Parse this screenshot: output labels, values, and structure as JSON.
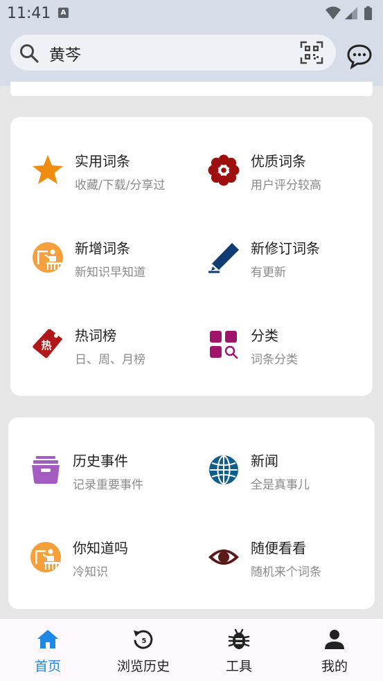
{
  "status_bar": {
    "time": "11:41",
    "notification_letter": "A"
  },
  "search": {
    "query": "黄芩"
  },
  "sections": [
    {
      "items": [
        {
          "title": "实用词条",
          "subtitle": "收藏/下载/分享过",
          "icon": "star-icon",
          "color": "#f08c12"
        },
        {
          "title": "优质词条",
          "subtitle": "用户评分较高",
          "icon": "flower-icon",
          "color": "#9e1010"
        },
        {
          "title": "新增词条",
          "subtitle": "新知识早知道",
          "icon": "teacher-icon",
          "color": "#f5a03c"
        },
        {
          "title": "新修订词条",
          "subtitle": "有更新",
          "icon": "pencil-icon",
          "color": "#0f3d73"
        },
        {
          "title": "热词榜",
          "subtitle": "日、周、月榜",
          "icon": "hot-tag-icon",
          "color": "#b21818",
          "badge": "热"
        },
        {
          "title": "分类",
          "subtitle": "词条分类",
          "icon": "category-icon",
          "color": "#a0146e"
        }
      ]
    },
    {
      "items": [
        {
          "title": "历史事件",
          "subtitle": "记录重要事件",
          "icon": "archive-box-icon",
          "color": "#a35cc0"
        },
        {
          "title": "新闻",
          "subtitle": "全是真事儿",
          "icon": "globe-icon",
          "color": "#0f5d8c"
        },
        {
          "title": "你知道吗",
          "subtitle": "冷知识",
          "icon": "teacher-icon",
          "color": "#f5a03c"
        },
        {
          "title": "随便看看",
          "subtitle": "随机来个词条",
          "icon": "eye-icon",
          "color": "#5a1a1a"
        }
      ]
    }
  ],
  "bottom_nav": [
    {
      "label": "首页",
      "icon": "home-icon",
      "active": true,
      "history_count": ""
    },
    {
      "label": "浏览历史",
      "icon": "history-icon",
      "active": false,
      "history_count": "5"
    },
    {
      "label": "工具",
      "icon": "bug-tool-icon",
      "active": false,
      "history_count": ""
    },
    {
      "label": "我的",
      "icon": "person-icon",
      "active": false,
      "history_count": ""
    }
  ],
  "colors": {
    "accent": "#1e88e5",
    "header_bg": "#d6dde8",
    "page_bg": "#e6e6e6"
  }
}
